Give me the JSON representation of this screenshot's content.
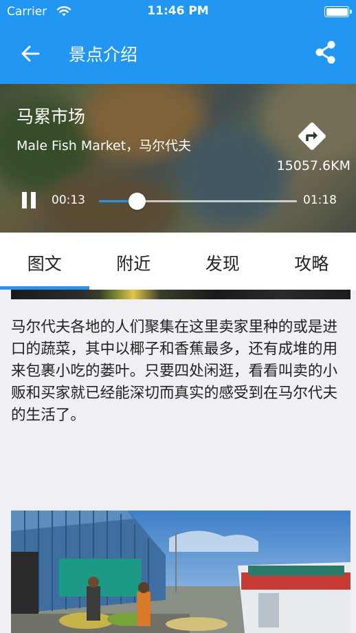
{
  "status_bar": {
    "carrier": "Carrier",
    "time": "11:46 PM"
  },
  "nav": {
    "title": "景点介绍"
  },
  "spot": {
    "name": "马累市场",
    "subtitle": "Male Fish Market，马尔代夫",
    "distance": "15057.6KM"
  },
  "player": {
    "current_time": "00:13",
    "total_time": "01:18",
    "progress": 0.19,
    "state": "playing"
  },
  "tabs": [
    {
      "label": "图文",
      "selected": true
    },
    {
      "label": "附近",
      "selected": false
    },
    {
      "label": "发现",
      "selected": false
    },
    {
      "label": "攻略",
      "selected": false
    }
  ],
  "article": {
    "text": "马尔代夫各地的人们聚集在这里卖家里种的或是进口的蔬菜，其中以椰子和香蕉最多，还有成堆的用来包裹小吃的蒌叶。只要四处闲逛，看看叫卖的小贩和买家就已经能深切而真实的感受到在马尔代夫的生活了。"
  },
  "colors": {
    "primary": "#2196f3",
    "background": "#efeff4"
  },
  "icons": [
    "back-arrow-icon",
    "share-icon",
    "wifi-icon",
    "battery-icon",
    "directions-icon",
    "pause-icon"
  ]
}
